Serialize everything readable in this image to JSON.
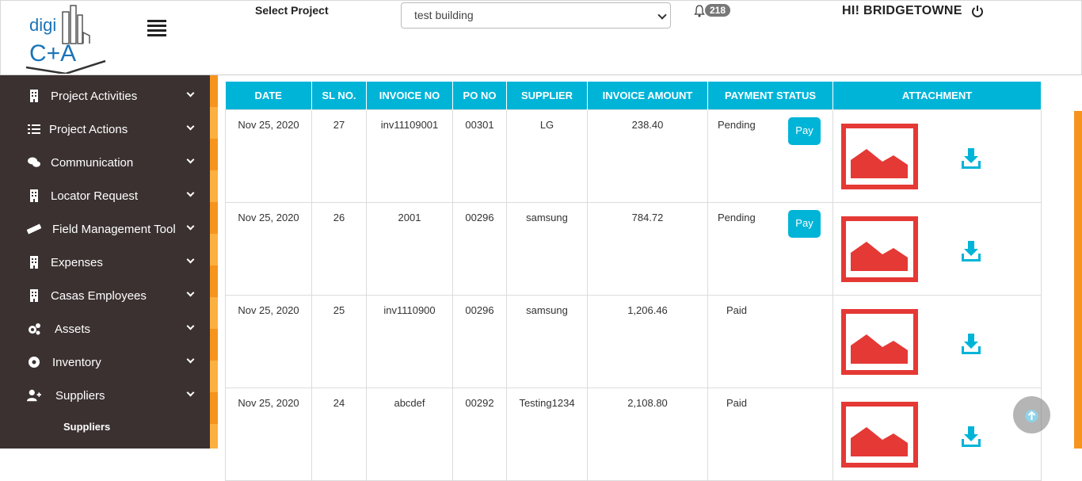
{
  "header": {
    "logo_text_top": "digi",
    "logo_text_bottom": "C+A",
    "select_label": "Select Project",
    "selected_project": "test building",
    "notification_count": "218",
    "greeting": "HI! BRIDGETOWNE"
  },
  "sidebar": {
    "items": [
      {
        "label": "Project Activities",
        "icon": "building-icon"
      },
      {
        "label": "Project Actions",
        "icon": "list-icon"
      },
      {
        "label": "Communication",
        "icon": "comments-icon"
      },
      {
        "label": "Locator Request",
        "icon": "building-icon"
      },
      {
        "label": "Field Management Tool",
        "icon": "ruler-icon"
      },
      {
        "label": "Expenses",
        "icon": "building-icon"
      },
      {
        "label": "Casas Employees",
        "icon": "building-icon"
      },
      {
        "label": "Assets",
        "icon": "cogs-icon"
      },
      {
        "label": "Inventory",
        "icon": "gear-icon"
      },
      {
        "label": "Suppliers",
        "icon": "user-plus-icon"
      }
    ],
    "sub_item": "Suppliers"
  },
  "table": {
    "headers": [
      "DATE",
      "SL NO.",
      "INVOICE NO",
      "PO NO",
      "SUPPLIER",
      "INVOICE AMOUNT",
      "PAYMENT STATUS",
      "ATTACHMENT"
    ],
    "pay_label": "Pay",
    "rows": [
      {
        "date": "Nov 25, 2020",
        "sl": "27",
        "invoice": "inv11109001",
        "po": "00301",
        "supplier": "LG",
        "amount": "238.40",
        "status": "Pending"
      },
      {
        "date": "Nov 25, 2020",
        "sl": "26",
        "invoice": "2001",
        "po": "00296",
        "supplier": "samsung",
        "amount": "784.72",
        "status": "Pending"
      },
      {
        "date": "Nov 25, 2020",
        "sl": "25",
        "invoice": "inv1110900",
        "po": "00296",
        "supplier": "samsung",
        "amount": "1,206.46",
        "status": "Paid"
      },
      {
        "date": "Nov 25, 2020",
        "sl": "24",
        "invoice": "abcdef",
        "po": "00292",
        "supplier": "Testing1234",
        "amount": "2,108.80",
        "status": "Paid"
      }
    ]
  },
  "colors": {
    "accent": "#00b4d8",
    "sidebar": "#3b3131",
    "orange": "#f7941d",
    "image_icon": "#e53935"
  }
}
